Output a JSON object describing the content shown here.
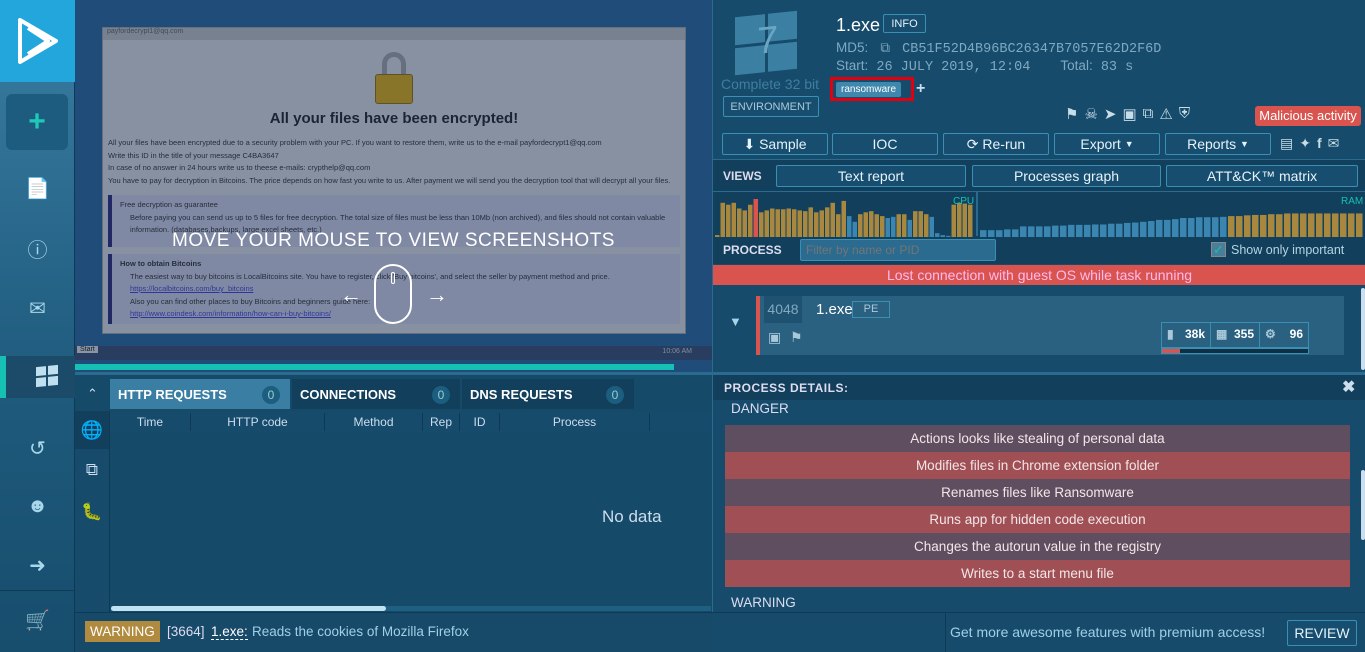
{
  "sidebar": {
    "items": [
      "new-task",
      "reports",
      "help",
      "contact",
      "windows",
      "history",
      "profile",
      "logout",
      "cart"
    ]
  },
  "screenshot": {
    "window_title": "payfordecrypt1@qq.com",
    "heading": "All your files have been encrypted!",
    "lines": [
      "All your files have been encrypted due to a security problem with your PC. If you want to restore them, write us to the e-mail payfordecrypt1@qq.com",
      "Write this ID in the title of your message C4BA3647",
      "In case of no answer in 24 hours write us to theese e-mails: crypthelp@qq.com",
      "You have to pay for decryption in Bitcoins. The price depends on how fast you write to us. After payment we will send you the decryption tool that will decrypt all your files."
    ],
    "box1_title": "Free decryption as guarantee",
    "box1_text": "Before paying you can send us up to 5 files for free decryption. The total size of files must be less than 10Mb (non archived), and files should not contain valuable information. (databases,backups, large excel sheets, etc.)",
    "box2_title": "How to obtain Bitcoins",
    "box2_text": "The easiest way to buy bitcoins is LocalBitcoins site. You have to register, click 'Buy bitcoins', and select the seller by payment method and price.",
    "box2_link1": "https://localbitcoins.com/buy_bitcoins",
    "box2_text2": "Also you can find other places to buy Bitcoins and beginners guide here:",
    "box2_link2": "http://www.coindesk.com/information/how-can-i-buy-bitcoins/",
    "overlay_text": "MOVE YOUR MOUSE TO VIEW SCREENSHOTS",
    "taskbar_start": "Start",
    "taskbar_clock": "10:06 AM",
    "progress": 0.94
  },
  "network": {
    "tabs": [
      {
        "label": "HTTP REQUESTS",
        "count": "0"
      },
      {
        "label": "CONNECTIONS",
        "count": "0"
      },
      {
        "label": "DNS REQUESTS",
        "count": "0"
      }
    ],
    "columns": [
      "Time",
      "HTTP code",
      "Method",
      "Rep",
      "ID",
      "Process"
    ],
    "empty": "No data"
  },
  "warning_bar": {
    "badge": "WARNING",
    "pid": "[3664]",
    "process": "1.exe:",
    "message": "Reads the cookies of Mozilla Firefox"
  },
  "task": {
    "os_version": "7",
    "os_label": "Complete 32 bit",
    "environment": "ENVIRONMENT",
    "filename": "1.exe",
    "info": "INFO",
    "md5_label": "MD5:",
    "md5": "CB51F52D4B96BC26347B7057E62D2F6D",
    "start_label": "Start:",
    "start": "26 JULY 2019, 12:04",
    "total_label": "Total:",
    "total": "83 s",
    "tag": "ransomware",
    "add_tag": "+",
    "verdict": "Malicious activity",
    "verdict_color": "#d9534f"
  },
  "actions": {
    "sample": "Sample",
    "ioc": "IOC",
    "rerun": "Re-run",
    "export": "Export",
    "reports": "Reports"
  },
  "views": {
    "label": "VIEWS",
    "text_report": "Text report",
    "processes_graph": "Processes graph",
    "attck": "ATT&CK™ matrix"
  },
  "monitor": {
    "cpu_label": "CPU",
    "ram_label": "RAM",
    "cpu": [
      0.05,
      0.9,
      0.85,
      0.9,
      0.75,
      0.7,
      0.85,
      1.0,
      0.65,
      0.7,
      0.75,
      0.73,
      0.73,
      0.75,
      0.73,
      0.7,
      0.68,
      0.78,
      0.65,
      0.7,
      0.78,
      0.9,
      0.6,
      0.95,
      0.55,
      0.4,
      0.6,
      0.65,
      0.68,
      0.6,
      0.55,
      0.5,
      0.53,
      0.6,
      0.6,
      0.45,
      0.68,
      0.68,
      0.6,
      0.53,
      0.1,
      0.05,
      0.03,
      0.85,
      0.9,
      0.88,
      0.85
    ],
    "cpu_high": [
      true,
      true,
      true,
      true,
      true,
      true,
      true,
      true,
      true,
      true,
      true,
      true,
      true,
      true,
      true,
      true,
      true,
      true,
      true,
      true,
      true,
      true,
      true,
      true,
      false,
      false,
      true,
      true,
      true,
      true,
      true,
      false,
      false,
      true,
      true,
      false,
      true,
      true,
      true,
      false,
      false,
      false,
      false,
      true,
      true,
      true,
      true
    ],
    "ram": [
      0.18,
      0.18,
      0.18,
      0.2,
      0.2,
      0.28,
      0.28,
      0.28,
      0.28,
      0.3,
      0.3,
      0.32,
      0.32,
      0.32,
      0.33,
      0.33,
      0.35,
      0.35,
      0.37,
      0.38,
      0.4,
      0.42,
      0.45,
      0.45,
      0.47,
      0.5,
      0.5,
      0.52,
      0.52,
      0.52,
      0.53,
      0.55,
      0.55,
      0.57,
      0.58,
      0.58,
      0.6,
      0.6,
      0.62,
      0.62,
      0.62,
      0.62,
      0.62,
      0.62,
      0.62,
      0.62,
      0.62,
      0.62
    ]
  },
  "process_filter": {
    "label": "PROCESS",
    "placeholder": "Filter by name or PID",
    "show_important": "Show only important",
    "checked": true
  },
  "banner": "Lost connection with guest OS while task running",
  "process": {
    "pid": "4048",
    "name": "1.exe",
    "type": "PE",
    "files": "38k",
    "registry": "355",
    "modules": "96",
    "danger_level": 0.12
  },
  "details": {
    "title": "PROCESS DETAILS:",
    "danger_label": "DANGER",
    "danger": [
      "Actions looks like stealing of personal data",
      "Modifies files in Chrome extension folder",
      "Renames files like Ransomware",
      "Runs app for hidden code execution",
      "Changes the autorun value in the registry",
      "Writes to a start menu file"
    ],
    "warning_label": "WARNING"
  },
  "promo": {
    "text": "Get more awesome features with premium access!",
    "button": "REVIEW"
  }
}
